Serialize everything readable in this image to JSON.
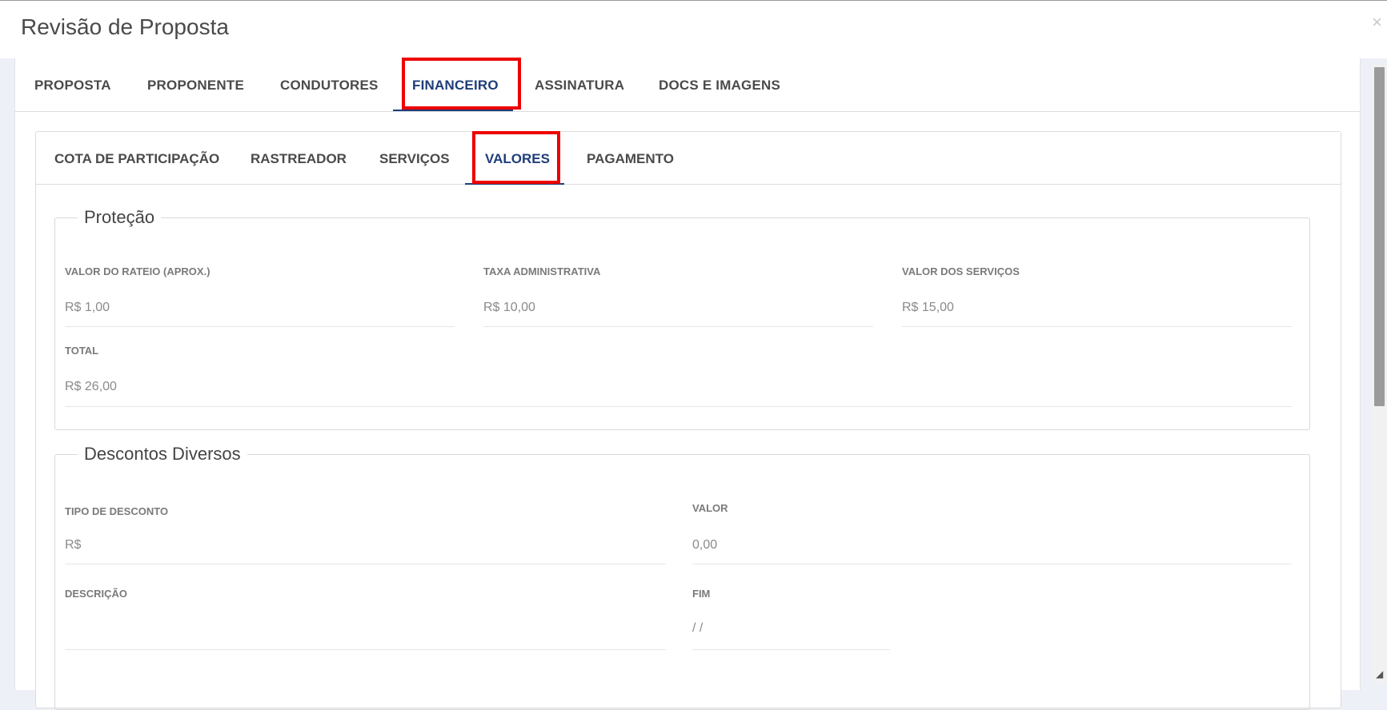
{
  "modal": {
    "title": "Revisão de Proposta",
    "close_label": "×"
  },
  "tabs": [
    {
      "label": "PROPOSTA"
    },
    {
      "label": "PROPONENTE"
    },
    {
      "label": "CONDUTORES"
    },
    {
      "label": "FINANCEIRO",
      "active": true
    },
    {
      "label": "ASSINATURA"
    },
    {
      "label": "DOCS E IMAGENS"
    }
  ],
  "subtabs": [
    {
      "label": "COTA DE PARTICIPAÇÃO"
    },
    {
      "label": "RASTREADOR"
    },
    {
      "label": "SERVIÇOS"
    },
    {
      "label": "VALORES",
      "active": true
    },
    {
      "label": "PAGAMENTO"
    }
  ],
  "protecao": {
    "legend": "Proteção",
    "valor_rateio": {
      "label": "VALOR DO RATEIO (APROX.)",
      "value": "R$ 1,00"
    },
    "taxa_admin": {
      "label": "TAXA ADMINISTRATIVA",
      "value": "R$ 10,00"
    },
    "valor_servicos": {
      "label": "VALOR DOS SERVIÇOS",
      "value": "R$ 15,00"
    },
    "total": {
      "label": "TOTAL",
      "value": "R$ 26,00"
    }
  },
  "descontos": {
    "legend": "Descontos Diversos",
    "tipo": {
      "label": "TIPO DE DESCONTO",
      "value": "R$"
    },
    "valor": {
      "label": "VALOR",
      "value": "0,00"
    },
    "descricao": {
      "label": "DESCRIÇÃO",
      "value": ""
    },
    "fim": {
      "label": "FIM",
      "value": "/ /"
    }
  },
  "colors": {
    "active_tab": "#1f3d7a",
    "highlight": "#ee0000"
  }
}
